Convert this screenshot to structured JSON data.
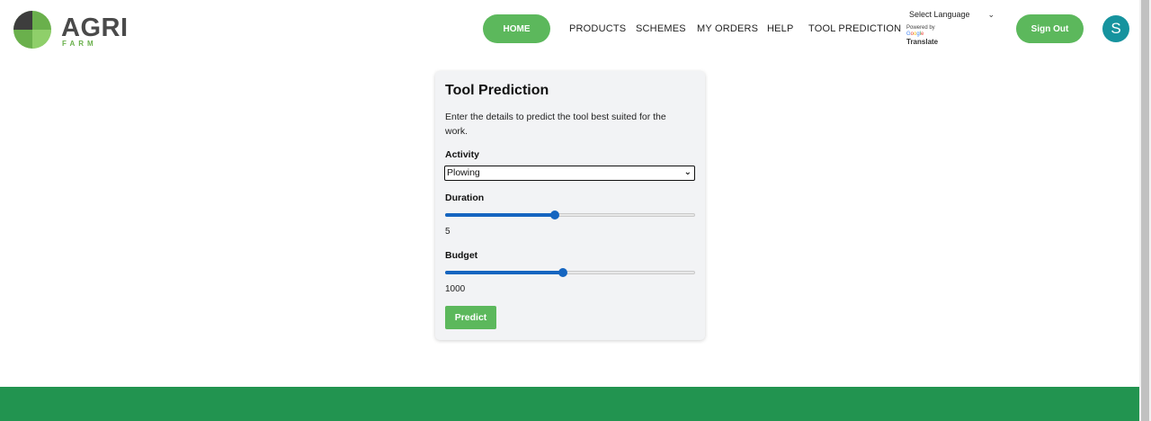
{
  "logo": {
    "main": "AGRI",
    "sub": "FARM"
  },
  "nav": {
    "home": "HOME",
    "products": "PRODUCTS",
    "schemes": "SCHEMES",
    "my_orders": "MY ORDERS",
    "help": "HELP",
    "tool_prediction": "TOOL PREDICTION"
  },
  "translate": {
    "select_label": "Select Language",
    "powered_by": "Powered by",
    "google": [
      "G",
      "o",
      "o",
      "g",
      "l",
      "e"
    ],
    "translate_word": "Translate"
  },
  "auth": {
    "sign_out": "Sign Out",
    "avatar_initial": "S"
  },
  "form": {
    "title": "Tool Prediction",
    "description": "Enter the details to predict the tool best suited for the work.",
    "activity_label": "Activity",
    "activity_value": "Plowing",
    "duration_label": "Duration",
    "duration_value": "5",
    "duration_fraction": 0.44,
    "budget_label": "Budget",
    "budget_value": "1000",
    "budget_fraction": 0.47,
    "predict_button": "Predict"
  },
  "colors": {
    "brand_green": "#5cb85c",
    "footer_green": "#229450",
    "slider_blue": "#1565c0",
    "avatar_teal": "#16939e"
  }
}
